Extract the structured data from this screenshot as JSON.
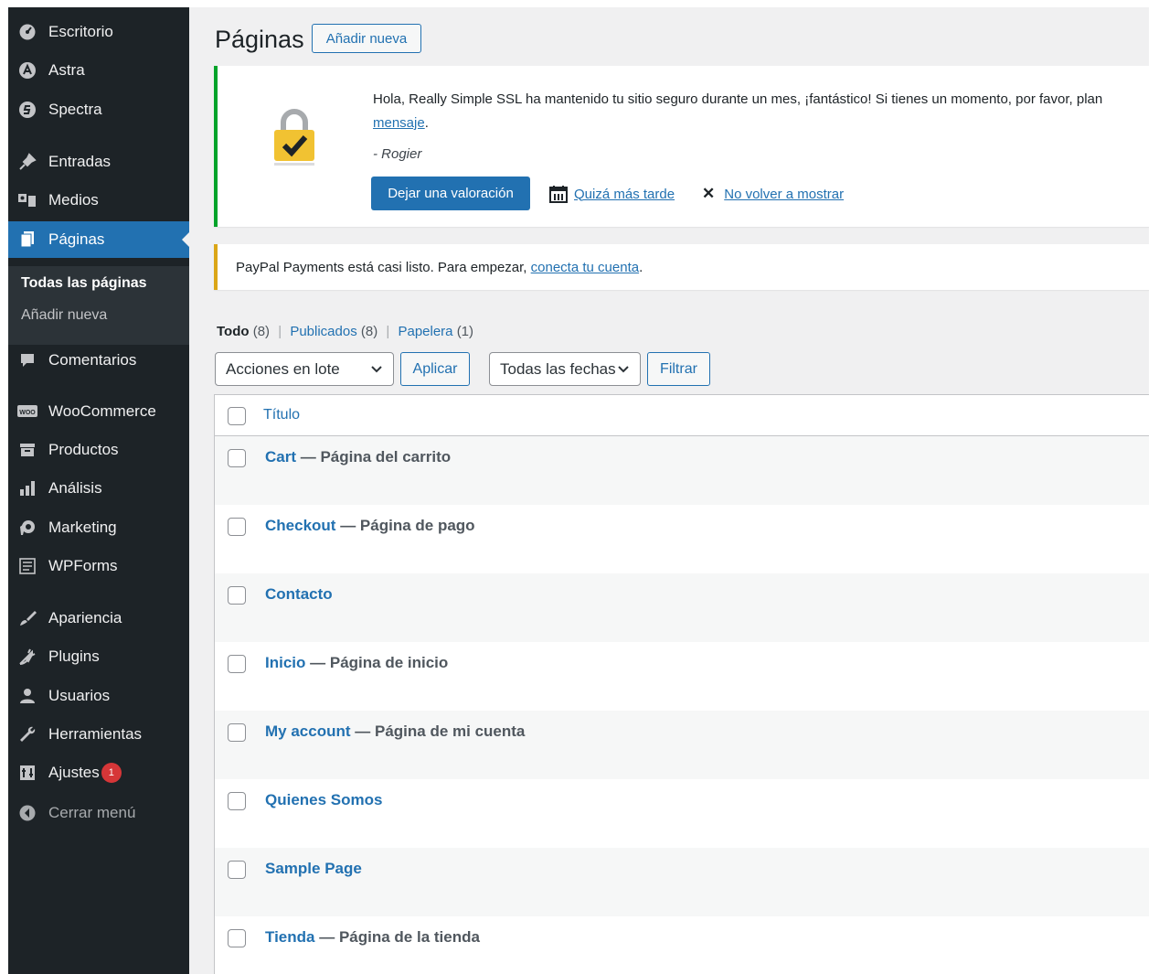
{
  "sidebar": {
    "items": [
      {
        "label": "Escritorio",
        "icon": "dashboard-icon"
      },
      {
        "label": "Astra",
        "icon": "astra-icon"
      },
      {
        "label": "Spectra",
        "icon": "spectra-icon"
      },
      {
        "label": "Entradas",
        "icon": "pin-icon"
      },
      {
        "label": "Medios",
        "icon": "media-icon"
      },
      {
        "label": "Páginas",
        "icon": "pages-icon",
        "active": true
      },
      {
        "label": "Comentarios",
        "icon": "comment-icon"
      },
      {
        "label": "WooCommerce",
        "icon": "woocommerce-icon"
      },
      {
        "label": "Productos",
        "icon": "archive-icon"
      },
      {
        "label": "Análisis",
        "icon": "chart-bar-icon"
      },
      {
        "label": "Marketing",
        "icon": "megaphone-icon"
      },
      {
        "label": "WPForms",
        "icon": "forms-icon"
      },
      {
        "label": "Apariencia",
        "icon": "brush-icon"
      },
      {
        "label": "Plugins",
        "icon": "plugin-icon"
      },
      {
        "label": "Usuarios",
        "icon": "user-icon"
      },
      {
        "label": "Herramientas",
        "icon": "wrench-icon"
      },
      {
        "label": "Ajustes",
        "icon": "settings-icon",
        "badge": "1"
      },
      {
        "label": "Cerrar menú",
        "icon": "collapse-icon"
      }
    ],
    "submenu": {
      "all_pages": "Todas las páginas",
      "add_new": "Añadir nueva"
    }
  },
  "header": {
    "title": "Páginas",
    "add_new": "Añadir nueva"
  },
  "ssl_notice": {
    "text": "Hola, Really Simple SSL ha mantenido tu sitio seguro durante un mes, ¡fantástico! Si tienes un momento, por favor, plan",
    "link": "mensaje",
    "link_suffix": ".",
    "signature": "- Rogier",
    "rate_button": "Dejar una valoración",
    "later_link": "Quizá más tarde",
    "dismiss_link": "No volver a mostrar",
    "accent": "#00a32a"
  },
  "paypal_notice": {
    "text": "PayPal Payments está casi listo. Para empezar, ",
    "link": "conecta tu cuenta",
    "suffix": ".",
    "accent": "#dba617"
  },
  "filters": {
    "all": "Todo",
    "all_count": "(8)",
    "published": "Publicados",
    "published_count": "(8)",
    "trash": "Papelera",
    "trash_count": "(1)"
  },
  "bulk": {
    "select": "Acciones en lote",
    "apply": "Aplicar",
    "dates": "Todas las fechas",
    "filter": "Filtrar"
  },
  "table": {
    "header_title": "Título",
    "rows": [
      {
        "title": "Cart",
        "state": "— Página del carrito"
      },
      {
        "title": "Checkout",
        "state": "— Página de pago"
      },
      {
        "title": "Contacto",
        "state": ""
      },
      {
        "title": "Inicio",
        "state": "— Página de inicio"
      },
      {
        "title": "My account",
        "state": "— Página de mi cuenta"
      },
      {
        "title": "Quienes Somos",
        "state": ""
      },
      {
        "title": "Sample Page",
        "state": ""
      },
      {
        "title": "Tienda",
        "state": "— Página de la tienda"
      }
    ]
  },
  "colors": {
    "sidebar_bg": "#1d2327",
    "active": "#2271b1",
    "link": "#2271b1",
    "badge": "#d63638"
  }
}
